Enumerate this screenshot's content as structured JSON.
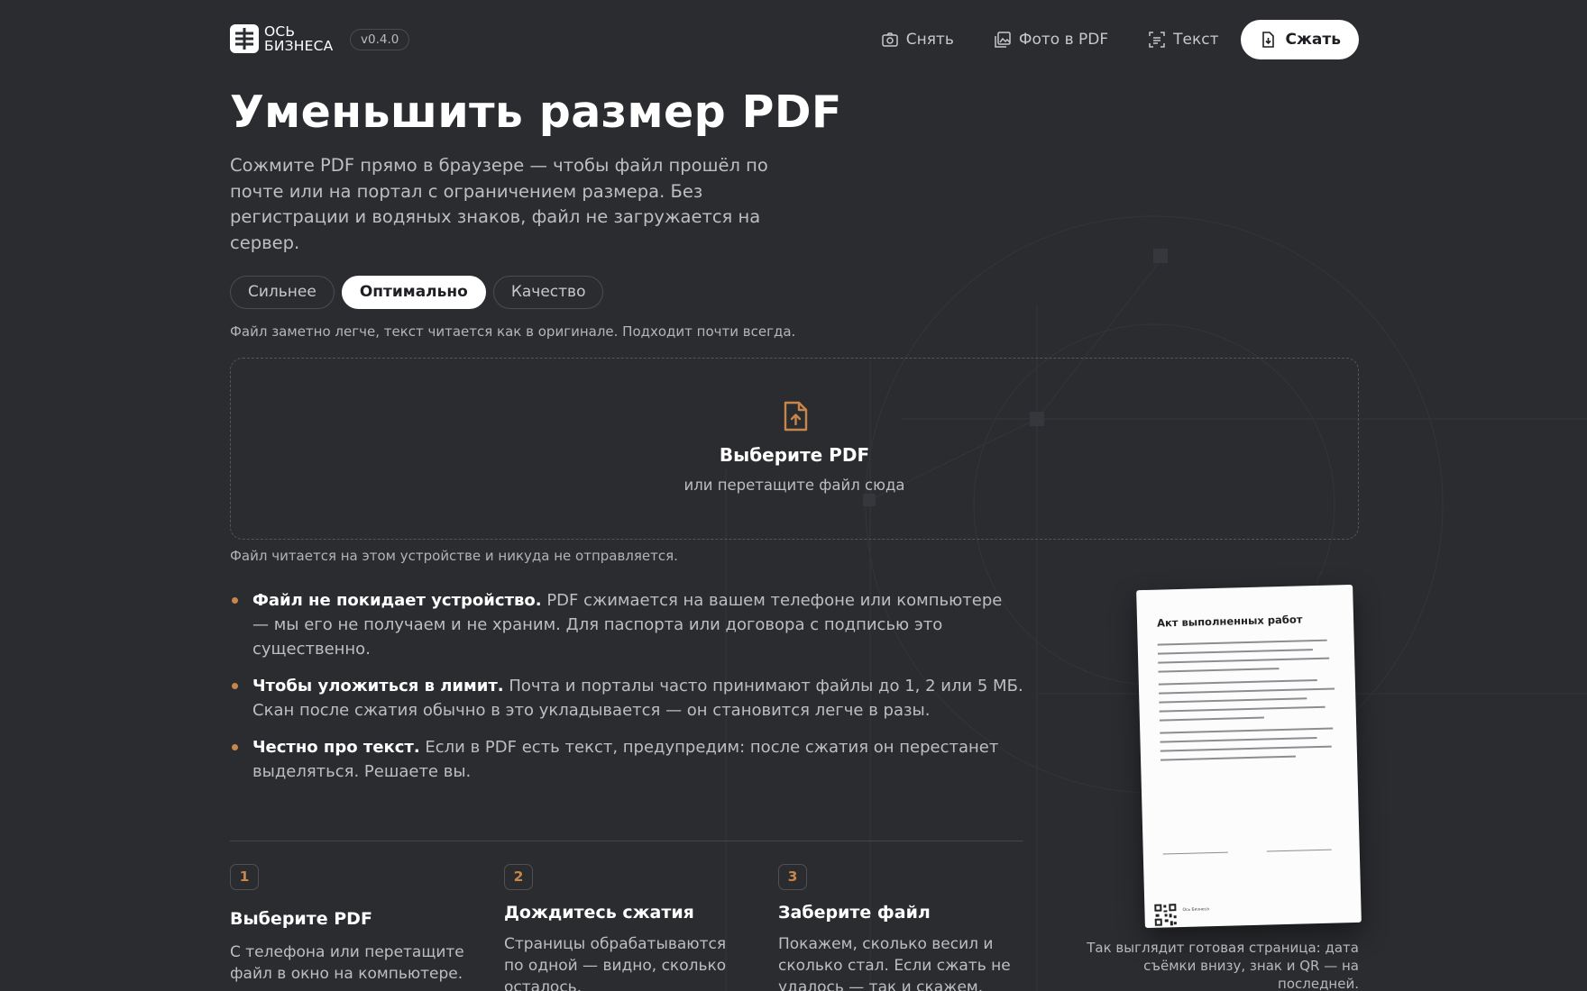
{
  "header": {
    "logo_line1": "ОСЬ",
    "logo_line2": "БИЗНЕСА",
    "version": "v0.4.0",
    "nav": [
      {
        "label": "Снять",
        "icon": "camera-icon"
      },
      {
        "label": "Фото в PDF",
        "icon": "images-icon"
      },
      {
        "label": "Текст",
        "icon": "text-scan-icon"
      },
      {
        "label": "Сжать",
        "icon": "file-compress-icon",
        "active": true
      }
    ]
  },
  "hero": {
    "title": "Уменьшить размер PDF",
    "subtitle": "Сожмите PDF прямо в браузере — чтобы файл прошёл по почте или на портал с ограничением размера. Без регистрации и водяных знаков, файл не загружается на сервер."
  },
  "modes": {
    "options": [
      "Сильнее",
      "Оптимально",
      "Качество"
    ],
    "selected": "Оптимально",
    "hint": "Файл заметно легче, текст читается как в оригинале. Подходит почти всегда."
  },
  "dropzone": {
    "title": "Выберите PDF",
    "subtitle": "или перетащите файл сюда",
    "note": "Файл читается на этом устройстве и никуда не отправляется."
  },
  "benefits": [
    {
      "bold": "Файл не покидает устройство.",
      "text": " PDF сжимается на вашем телефоне или компьютере — мы его не получаем и не храним. Для паспорта или договора с подписью это существенно."
    },
    {
      "bold": "Чтобы уложиться в лимит.",
      "text": " Почта и порталы часто принимают файлы до 1, 2 или 5 МБ. Скан после сжатия обычно в это укладывается — он становится легче в разы."
    },
    {
      "bold": "Честно про текст.",
      "text": " Если в PDF есть текст, предупредим: после сжатия он перестанет выделяться. Решаете вы."
    }
  ],
  "steps": [
    {
      "num": "1",
      "title": "Выберите PDF",
      "text": "С телефона или перетащите файл в окно на компьютере."
    },
    {
      "num": "2",
      "title": "Дождитесь сжатия",
      "text": "Страницы обрабатываются по одной — видно, сколько осталось."
    },
    {
      "num": "3",
      "title": "Заберите файл",
      "text": "Покажем, сколько весил и сколько стал. Если сжать не удалось — так и скажем."
    }
  ],
  "preview": {
    "doc_title": "Акт выполненных работ",
    "doc_brand": "Ось Бизнеса",
    "caption": "Так выглядит готовая страница: дата съёмки внизу, знак и QR — на последней."
  },
  "colors": {
    "background": "#2b2c30",
    "accent": "#c8874a",
    "text": "#f2f2f2",
    "muted": "#bdbec1"
  }
}
